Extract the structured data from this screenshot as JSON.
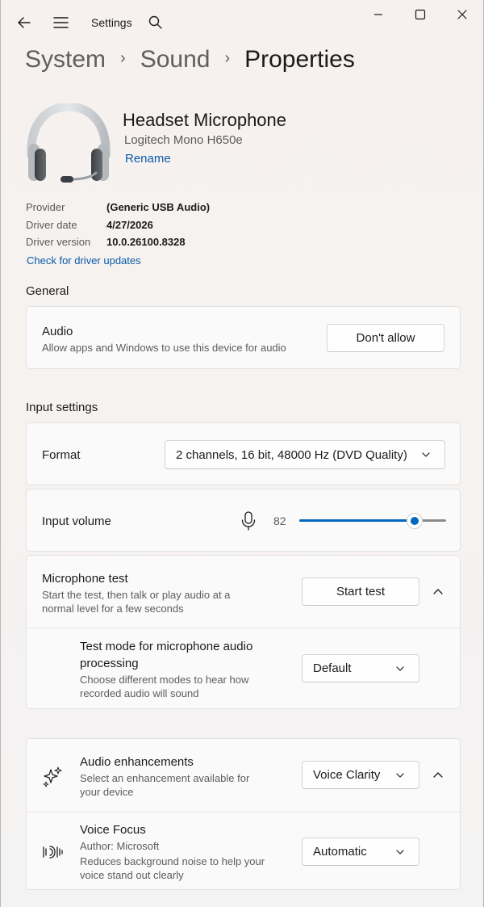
{
  "titlebar": {
    "title": "Settings",
    "icons": [
      "back-arrow-icon",
      "hamburger-menu-icon",
      "search-icon",
      "minimize-icon",
      "maximize-icon",
      "close-icon"
    ]
  },
  "breadcrumb": {
    "items": [
      "System",
      "Sound"
    ],
    "current": "Properties",
    "separator": "›"
  },
  "device": {
    "name": "Headset Microphone",
    "model": "Logitech Mono H650e",
    "rename_label": "Rename",
    "icon": "headset-icon"
  },
  "properties": [
    {
      "label": "Provider",
      "value": "(Generic USB Audio)"
    },
    {
      "label": "Driver date",
      "value": "4/27/2026"
    },
    {
      "label": "Driver version",
      "value": "10.0.26100.8328"
    }
  ],
  "driver_link": "Check for driver updates",
  "general": {
    "heading": "General",
    "audio": {
      "title": "Audio",
      "subtitle": "Allow apps and Windows to use this device for audio",
      "button": "Don't allow"
    }
  },
  "input_settings": {
    "heading": "Input settings",
    "format": {
      "label": "Format",
      "selected": "2 channels, 16 bit, 48000 Hz (DVD Quality)"
    },
    "volume": {
      "label": "Input volume",
      "value_text": "82",
      "value": 82,
      "max": 100
    },
    "mic_test": {
      "title": "Microphone test",
      "subtitle_line1": "Start the test, then talk or play audio at a",
      "subtitle_line2": "normal level for a few seconds",
      "button": "Start test"
    },
    "test_mode": {
      "title_line1": "Test mode for microphone audio",
      "title_line2": "processing",
      "subtitle_line1": "Choose different modes to hear how",
      "subtitle_line2": "recorded audio will sound",
      "selected": "Default"
    }
  },
  "enhancements": {
    "title": "Audio enhancements",
    "subtitle_line1": "Select an enhancement available for",
    "subtitle_line2": "your device",
    "selected": "Voice Clarity",
    "icon": "sparkle-icon"
  },
  "voice_focus": {
    "title": "Voice Focus",
    "author": "Author: Microsoft",
    "subtitle_line1": "Reduces background noise to help your",
    "subtitle_line2": "voice stand out clearly",
    "selected": "Automatic",
    "icon": "voice-focus-icon"
  },
  "colors": {
    "accent": "#0067c0",
    "link": "#0b5aa8"
  }
}
